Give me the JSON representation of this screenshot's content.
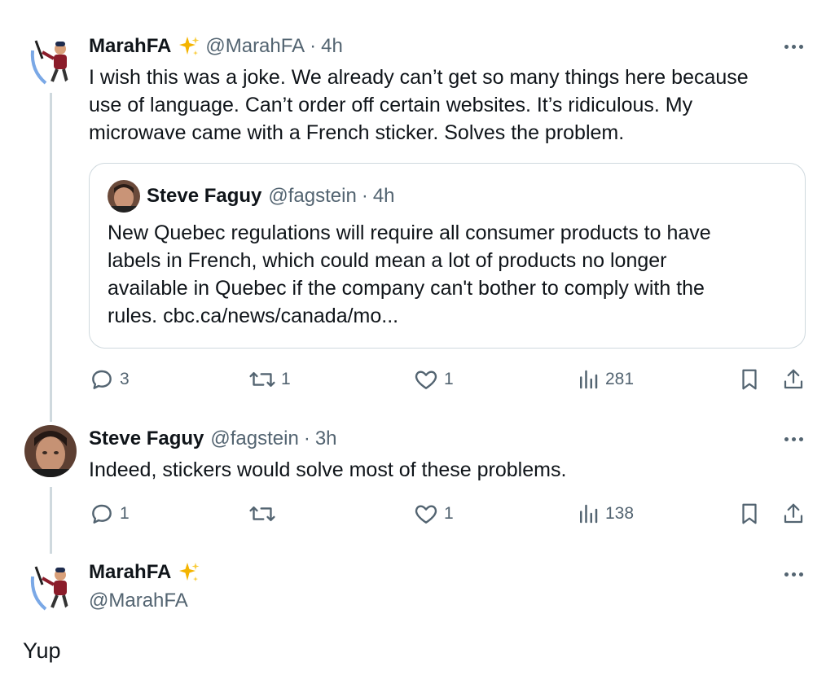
{
  "thread": [
    {
      "author": {
        "name": "MarahFA",
        "handle": "@MarahFA",
        "verified_emoji": "sparkles-icon"
      },
      "separator": "·",
      "time": "4h",
      "text": "I wish this was a joke. We already can’t get so many things here because\nuse of language. Can’t order off certain websites. It’s ridiculous. My\nmicrowave came with a French sticker. Solves  the problem.",
      "quote": {
        "author": {
          "name": "Steve Faguy",
          "handle": "@fagstein"
        },
        "separator": "·",
        "time": "4h",
        "text": "New Quebec regulations will require all consumer products to have\nlabels in French, which could mean a lot of products no longer\navailable in Quebec if the company can't bother to comply with the\nrules.  cbc.ca/news/canada/mo..."
      },
      "stats": {
        "replies": "3",
        "reposts": "1",
        "likes": "1",
        "views": "281"
      }
    },
    {
      "author": {
        "name": "Steve Faguy",
        "handle": "@fagstein"
      },
      "separator": "·",
      "time": "3h",
      "text": "Indeed, stickers would solve most of these problems.",
      "stats": {
        "replies": "1",
        "reposts": "",
        "likes": "1",
        "views": "138"
      }
    }
  ],
  "focused": {
    "author": {
      "name": "MarahFA",
      "handle": "@MarahFA",
      "verified_emoji": "sparkles-icon"
    },
    "text": "Yup"
  },
  "colors": {
    "text": "#0f1419",
    "secondary": "#536471",
    "border": "#cfd9de",
    "sparkle": "#f4b400"
  }
}
